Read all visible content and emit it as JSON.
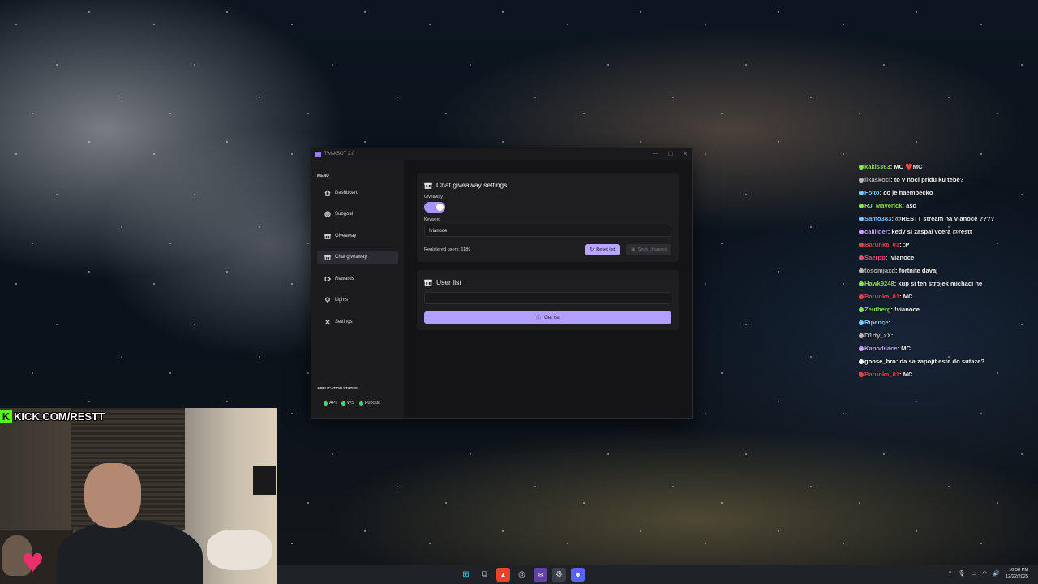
{
  "app": {
    "title": "TwiskBOT 2.0",
    "window_controls": [
      "—",
      "☐",
      "✕"
    ],
    "menu_label": "MENU",
    "nav": [
      {
        "label": "Dashboard",
        "icon": "home-icon"
      },
      {
        "label": "Subgoal",
        "icon": "target-icon"
      },
      {
        "label": "Giveaway",
        "icon": "gift-icon"
      },
      {
        "label": "Chat giveaway",
        "icon": "chat-gift-icon",
        "active": true
      },
      {
        "label": "Rewards",
        "icon": "reward-icon"
      },
      {
        "label": "Lights",
        "icon": "bulb-icon"
      },
      {
        "label": "Settings",
        "icon": "tools-icon"
      }
    ],
    "status_label": "APPLICATION STATUS",
    "status": [
      "API",
      "WS",
      "PubSub"
    ],
    "status_color": "#3ddc6a",
    "accent": "#b39fff"
  },
  "chat_giveaway": {
    "title": "Chat giveaway settings",
    "giveaway_label": "Giveaway",
    "giveaway_enabled": true,
    "keyword_label": "Keyword",
    "keyword_value": "!vianoce",
    "registered_text": "Registered users: 1189",
    "reset_label": "Reset list",
    "save_label": "Save changes"
  },
  "user_list": {
    "title": "User list",
    "get_label": "Get list"
  },
  "chat": [
    {
      "user": "kakis363",
      "color": "#8ae05a",
      "text": "MC ❤️MC"
    },
    {
      "user": "llkaskoci",
      "color": "#b8b8b8",
      "text": "to v noci pridu ku tebe?"
    },
    {
      "user": "Folto",
      "color": "#7ec8ff",
      "text": "co je haembecko"
    },
    {
      "user": "RJ_Maverick",
      "color": "#8ae05a",
      "text": "asd"
    },
    {
      "user": "Samo383",
      "color": "#7ec8ff",
      "text": "@RESTT stream na Vianoce ????"
    },
    {
      "user": "callilder",
      "color": "#c8a0ff",
      "text": "kedy si zaspal vcera @restt"
    },
    {
      "user": "Barunka_01",
      "color": "#e04050",
      "text": ":P"
    },
    {
      "user": "Saerpp",
      "color": "#e05080",
      "text": "!vianoce"
    },
    {
      "user": "tosomjaxd",
      "color": "#b8b8b8",
      "text": "fortnite davaj"
    },
    {
      "user": "Hawk9248",
      "color": "#8ae05a",
      "text": "kup si ten strojek michaci ne"
    },
    {
      "user": "Barunka_01",
      "color": "#e04050",
      "text": "MC"
    },
    {
      "user": "Zeutberg",
      "color": "#8ae05a",
      "text": "!vianoce"
    },
    {
      "user": "Ripence",
      "color": "#7ec8ff",
      "text": ""
    },
    {
      "user": "D1rty_xX",
      "color": "#b8b8b8",
      "text": ""
    },
    {
      "user": "Kapodilace",
      "color": "#c8a0ff",
      "text": "MC"
    },
    {
      "user": "goose_bro",
      "color": "#ffffff",
      "text": "da sa zapojit este do sutaze?"
    },
    {
      "user": "Barunka_01",
      "color": "#e04050",
      "text": "MC"
    }
  ],
  "stream": {
    "kick_label": "KICK.COM/RESTT",
    "kick_color": "#53fc18"
  },
  "taskbar": {
    "icons": [
      "windows-icon",
      "taskview-icon",
      "brave-icon",
      "chrome-icon",
      "twitch-icon",
      "steam-icon",
      "discord-icon"
    ],
    "time": "10:58 PM",
    "date": "12/22/2025"
  }
}
